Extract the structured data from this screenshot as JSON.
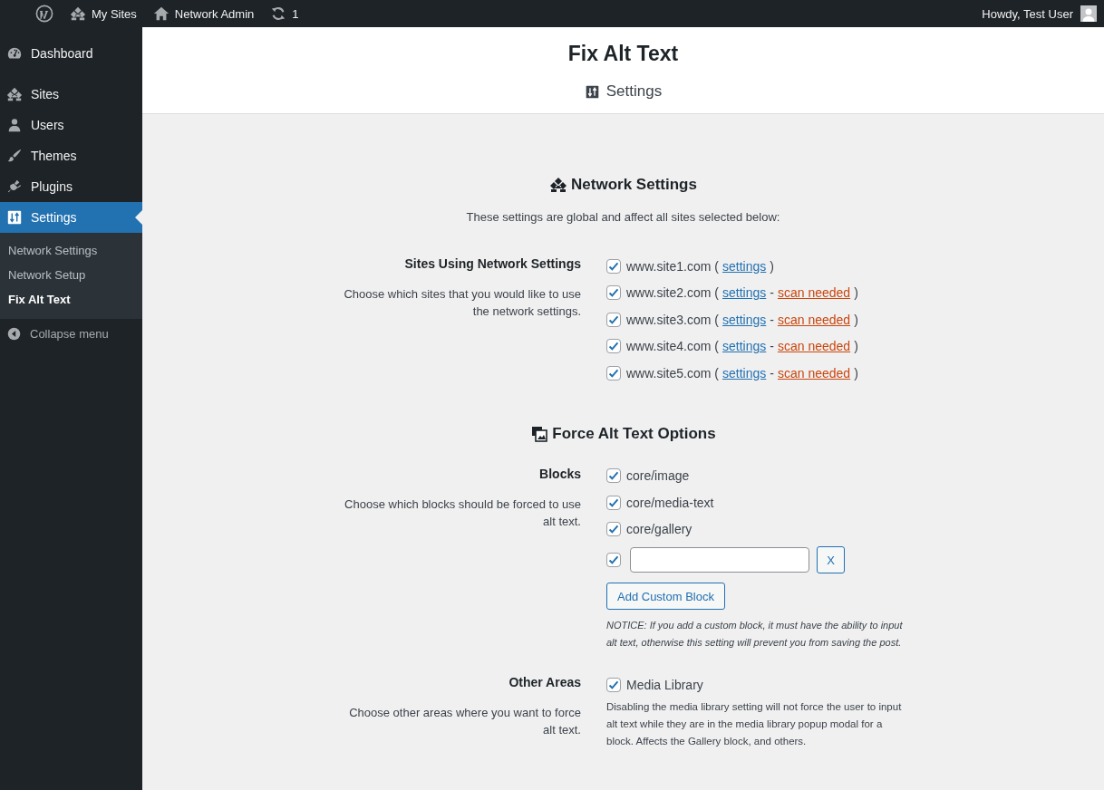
{
  "admin_bar": {
    "my_sites": "My Sites",
    "network_admin": "Network Admin",
    "updates": "1",
    "greeting": "Howdy, Test User"
  },
  "sidebar": {
    "menu": [
      {
        "label": "Dashboard",
        "selected": false
      },
      {
        "label": "Sites",
        "selected": false
      },
      {
        "label": "Users",
        "selected": false
      },
      {
        "label": "Themes",
        "selected": false
      },
      {
        "label": "Plugins",
        "selected": false
      },
      {
        "label": "Settings",
        "selected": true
      }
    ],
    "submenu": [
      {
        "label": "Network Settings",
        "selected": false
      },
      {
        "label": "Network Setup",
        "selected": false
      },
      {
        "label": "Fix Alt Text",
        "selected": true
      }
    ],
    "collapse": "Collapse menu"
  },
  "page": {
    "title": "Fix Alt Text",
    "tab": "Settings"
  },
  "sections": [
    {
      "heading": "Network Settings",
      "intro": "These settings are global and affect all sites selected below:",
      "fields": [
        {
          "label": "Sites Using Network Settings",
          "description": "Choose which sites that you would like to use the network settings.",
          "options": [
            {
              "kind": "site",
              "label": "www.site1.com",
              "checked": true,
              "open": "(",
              "settings_link": "settings",
              "close": ")"
            },
            {
              "kind": "site",
              "label": "www.site2.com",
              "checked": true,
              "open": "(",
              "settings_link": "settings",
              "separator": "-",
              "scan_link": "scan needed",
              "close": ")"
            },
            {
              "kind": "site",
              "label": "www.site3.com",
              "checked": true,
              "open": "(",
              "settings_link": "settings",
              "separator": "-",
              "scan_link": "scan needed",
              "close": ")"
            },
            {
              "kind": "site",
              "label": "www.site4.com",
              "checked": true,
              "open": "(",
              "settings_link": "settings",
              "separator": "-",
              "scan_link": "scan needed",
              "close": ")"
            },
            {
              "kind": "site",
              "label": "www.site5.com",
              "checked": true,
              "open": "(",
              "settings_link": "settings",
              "separator": "-",
              "scan_link": "scan needed",
              "close": ")"
            }
          ]
        }
      ]
    },
    {
      "heading": "Force Alt Text Options",
      "fields": [
        {
          "label": "Blocks",
          "description": "Choose which blocks should be forced to use alt text.",
          "options": [
            {
              "kind": "checkbox",
              "label": "core/image",
              "checked": true
            },
            {
              "kind": "checkbox",
              "label": "core/media-text",
              "checked": true
            },
            {
              "kind": "checkbox",
              "label": "core/gallery",
              "checked": true
            },
            {
              "kind": "custom",
              "checked": true,
              "remove": "X"
            }
          ],
          "add_button": "Add Custom Block",
          "notice": "NOTICE: If you add a custom block, it must have the ability to input alt text, otherwise this setting will prevent you from saving the post."
        },
        {
          "label": "Other Areas",
          "description": "Choose other areas where you want to force alt text.",
          "options": [
            {
              "kind": "checkbox",
              "label": "Media Library",
              "checked": true,
              "help": "Disabling the media library setting will not force the user to input alt text while they are in the media library popup modal for a block. Affects the Gallery block, and others."
            }
          ]
        }
      ]
    }
  ]
}
